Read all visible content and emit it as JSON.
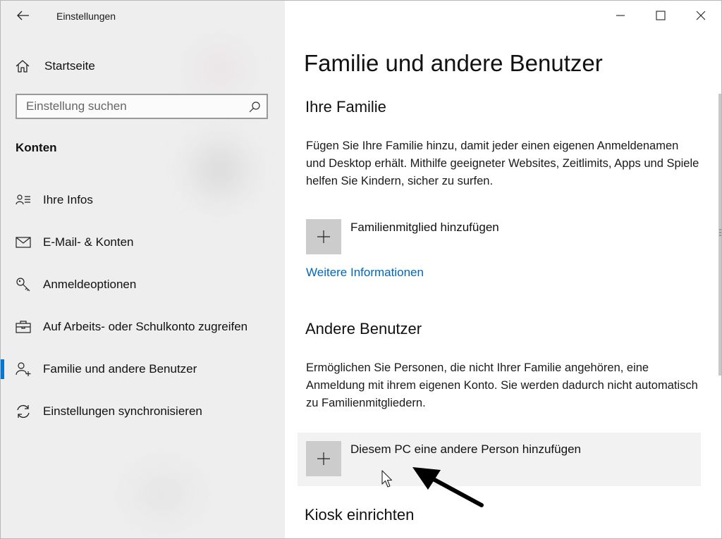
{
  "window": {
    "title": "Einstellungen"
  },
  "sidebar": {
    "home_label": "Startseite",
    "search": {
      "placeholder": "Einstellung suchen",
      "value": ""
    },
    "section_label": "Konten",
    "items": [
      {
        "label": "Ihre Infos",
        "icon": "contact-card-icon",
        "selected": false
      },
      {
        "label": "E-Mail- & Konten",
        "icon": "mail-icon",
        "selected": false
      },
      {
        "label": "Anmeldeoptionen",
        "icon": "key-icon",
        "selected": false
      },
      {
        "label": "Auf Arbeits- oder Schulkonto zugreifen",
        "icon": "briefcase-icon",
        "selected": false
      },
      {
        "label": "Familie und andere Benutzer",
        "icon": "add-person-icon",
        "selected": true
      },
      {
        "label": "Einstellungen synchronisieren",
        "icon": "sync-icon",
        "selected": false
      }
    ]
  },
  "main": {
    "page_title": "Familie und andere Benutzer",
    "family": {
      "heading": "Ihre Familie",
      "description": "Fügen Sie Ihre Familie hinzu, damit jeder einen eigenen Anmeldenamen und Desktop erhält. Mithilfe geeigneter Websites, Zeitlimits, Apps und Spiele helfen Sie Kindern, sicher zu surfen.",
      "add_label": "Familienmitglied hinzufügen",
      "more_info_link": "Weitere Informationen"
    },
    "other_users": {
      "heading": "Andere Benutzer",
      "description": "Ermöglichen Sie Personen, die nicht Ihrer Familie angehören, eine Anmeldung mit ihrem eigenen Konto. Sie werden dadurch nicht automatisch zu Familienmitgliedern.",
      "add_label": "Diesem PC eine andere Person hinzufügen"
    },
    "kiosk": {
      "heading": "Kiosk einrichten"
    }
  },
  "colors": {
    "accent": "#0078d7",
    "link": "#0067b8",
    "nav_background": "#eeeeee",
    "plus_tile": "#cccccc",
    "hover_row": "#f2f2f2"
  }
}
